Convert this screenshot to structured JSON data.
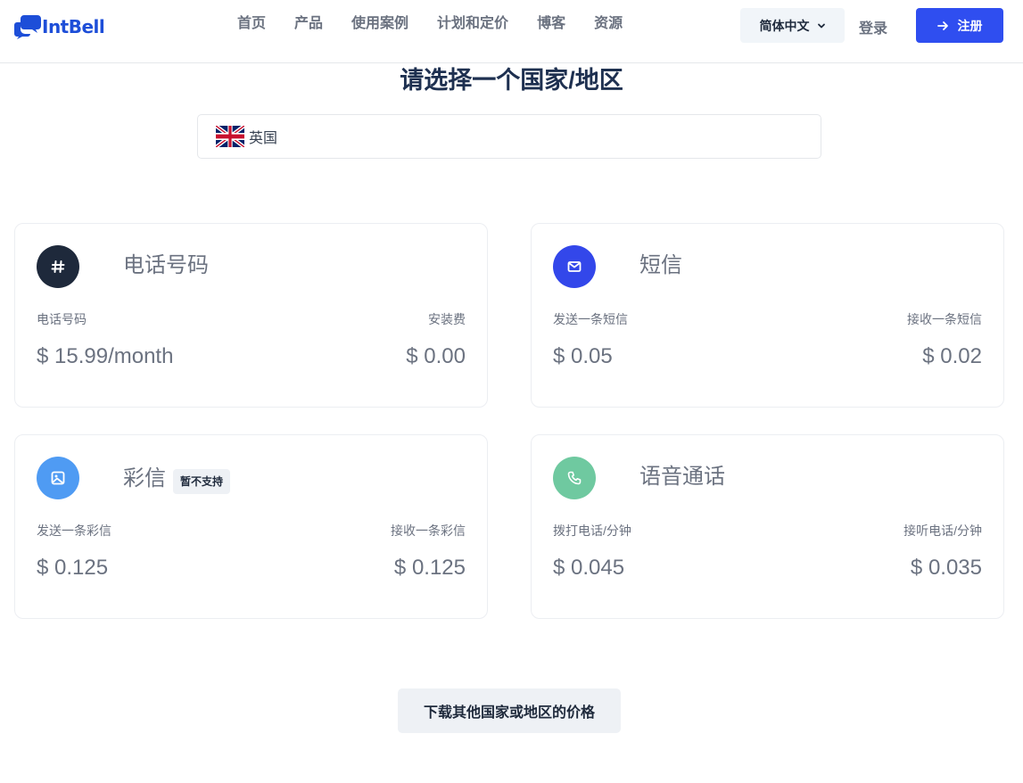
{
  "header": {
    "logo_text": "IntBell",
    "nav": [
      "首页",
      "产品",
      "使用案例",
      "计划和定价",
      "博客",
      "资源"
    ],
    "language": "简体中文",
    "login": "登录",
    "signup": "注册"
  },
  "main": {
    "title": "请选择一个国家/地区",
    "selected_country": "英国"
  },
  "cards": [
    {
      "title": "电话号码",
      "badge": "",
      "label_left": "电话号码",
      "value_left": "$ 15.99/month",
      "label_right": "安装费",
      "value_right": "$ 0.00",
      "icon": "hash-icon",
      "color": "#1e293b"
    },
    {
      "title": "短信",
      "badge": "",
      "label_left": "发送一条短信",
      "value_left": "$ 0.05",
      "label_right": "接收一条短信",
      "value_right": "$ 0.02",
      "icon": "mail-icon",
      "color": "#3347ea"
    },
    {
      "title": "彩信",
      "badge": "暂不支持",
      "label_left": "发送一条彩信",
      "value_left": "$ 0.125",
      "label_right": "接收一条彩信",
      "value_right": "$ 0.125",
      "icon": "image-icon",
      "color": "#4f9bf3"
    },
    {
      "title": "语音通话",
      "badge": "",
      "label_left": "拨打电话/分钟",
      "value_left": "$ 0.045",
      "label_right": "接听电话/分钟",
      "value_right": "$ 0.035",
      "icon": "phone-icon",
      "color": "#6fc9a0"
    }
  ],
  "footer": {
    "download": "下载其他国家或地区的价格"
  },
  "colors": {
    "brand": "#1d4ed8",
    "primary_button": "#2f4ef0"
  }
}
